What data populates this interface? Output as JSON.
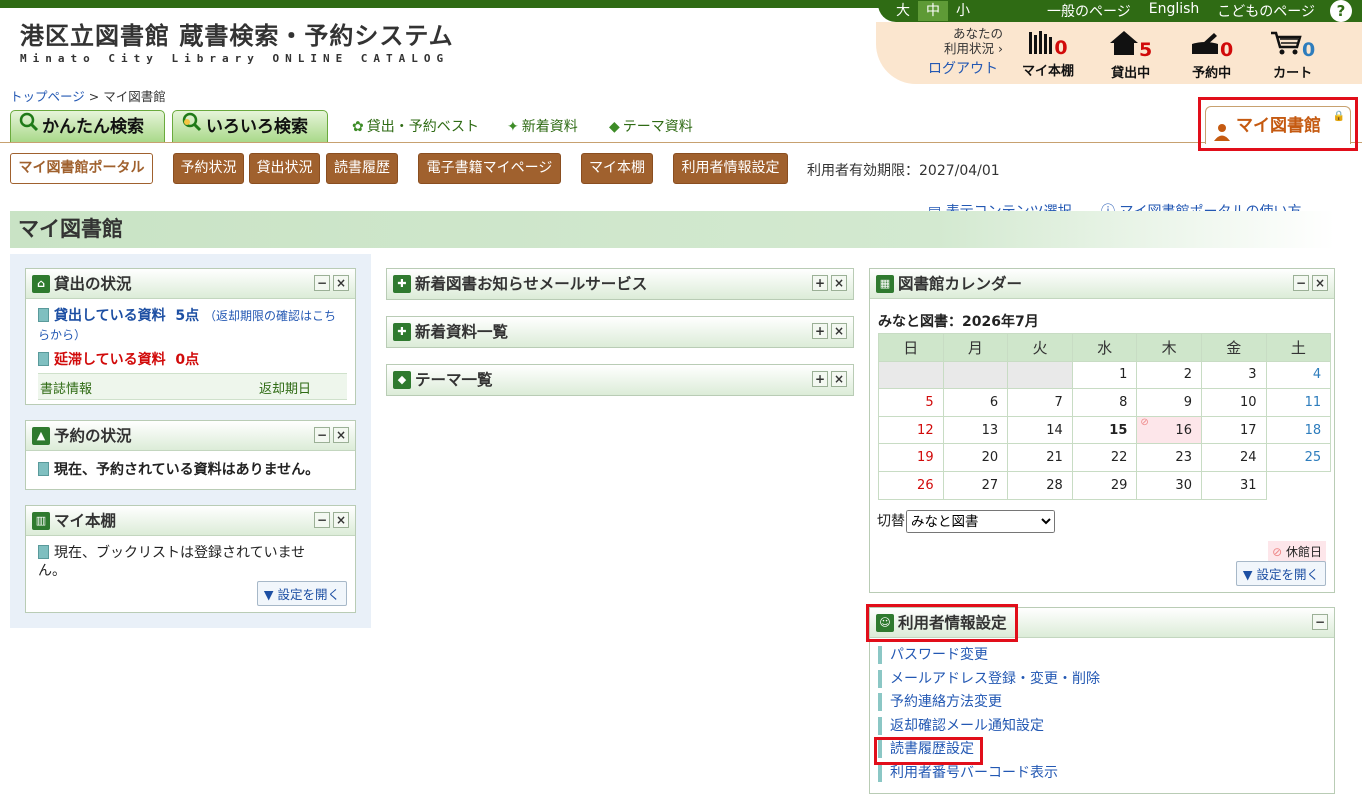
{
  "header": {
    "title": "港区立図書館 蔵書検索・予約システム",
    "subtitle": "Minato City Library ONLINE CATALOG",
    "font_sizes": [
      "大",
      "中",
      "小"
    ],
    "font_size_selected": "中",
    "links": [
      "一般のページ",
      "English",
      "こどものページ"
    ],
    "help": "?"
  },
  "status": {
    "label_line1": "あなたの",
    "label_line2": "利用状況",
    "logout": "ログアウト",
    "items": [
      {
        "label": "マイ本棚",
        "count": "0"
      },
      {
        "label": "貸出中",
        "count": "5"
      },
      {
        "label": "予約中",
        "count": "0"
      },
      {
        "label": "カート",
        "count": "0"
      }
    ]
  },
  "breadcrumb": {
    "home": "トップページ",
    "sep": " > ",
    "current": "マイ図書館"
  },
  "tabs": {
    "simple": "かんたん検索",
    "advanced": "いろいろ検索",
    "best": "貸出・予約ベスト",
    "new": "新着資料",
    "theme": "テーマ資料",
    "mylib": "マイ図書館"
  },
  "subnav": {
    "portal": "マイ図書館ポータル",
    "items": [
      "予約状況",
      "貸出状況",
      "読書履歴",
      "電子書籍マイページ",
      "マイ本棚",
      "利用者情報設定"
    ],
    "validity": "利用者有効期限：2027/04/01"
  },
  "section": {
    "title": "マイ図書館",
    "content_select": "表示コンテンツ選択",
    "howto": "マイ図書館ポータルの使い方"
  },
  "loans": {
    "title": "貸出の状況",
    "borrowed_label": "貸出している資料",
    "borrowed_count": "5点",
    "note": "（返却期限の確認はこちらから）",
    "overdue_label": "延滞している資料",
    "overdue_count": "0点",
    "col_title": "書誌情報",
    "col_due": "返却期日"
  },
  "reservations": {
    "title": "予約の状況",
    "message": "現在、予約されている資料はありません。"
  },
  "bookshelf": {
    "title": "マイ本棚",
    "message": "現在、ブックリストは登録されていません。",
    "settings_button": "▼ 設定を開く"
  },
  "middle": {
    "mail_service": "新着図書お知らせメールサービス",
    "new_items": "新着資料一覧",
    "themes": "テーマ一覧"
  },
  "calendar": {
    "title": "図書館カレンダー",
    "month_label": "みなと図書：2026年7月",
    "weekdays": [
      "日",
      "月",
      "火",
      "水",
      "木",
      "金",
      "土"
    ],
    "weeks": [
      [
        "",
        "",
        "",
        "1",
        "2",
        "3",
        "4"
      ],
      [
        "5",
        "6",
        "7",
        "8",
        "9",
        "10",
        "11"
      ],
      [
        "12",
        "13",
        "14",
        "15",
        "16",
        "17",
        "18"
      ],
      [
        "19",
        "20",
        "21",
        "22",
        "23",
        "24",
        "25"
      ],
      [
        "26",
        "27",
        "28",
        "29",
        "30",
        "31",
        ""
      ]
    ],
    "today": "15",
    "closed": [
      "16"
    ],
    "switch_label": "切替",
    "switch_value": "みなと図書",
    "legend": "休館日",
    "settings_button": "▼ 設定を開く"
  },
  "user_settings": {
    "title": "利用者情報設定",
    "links": [
      "パスワード変更",
      "メールアドレス登録・変更・削除",
      "予約連絡方法変更",
      "返却確認メール通知設定",
      "読書履歴設定",
      "利用者番号バーコード表示"
    ]
  },
  "colors": {
    "header_green": "#2f6b14",
    "status_bg": "#fbe6cf",
    "nav_brown": "#a0612e",
    "highlight_red": "#e10e1a",
    "link_blue": "#2358b3"
  }
}
